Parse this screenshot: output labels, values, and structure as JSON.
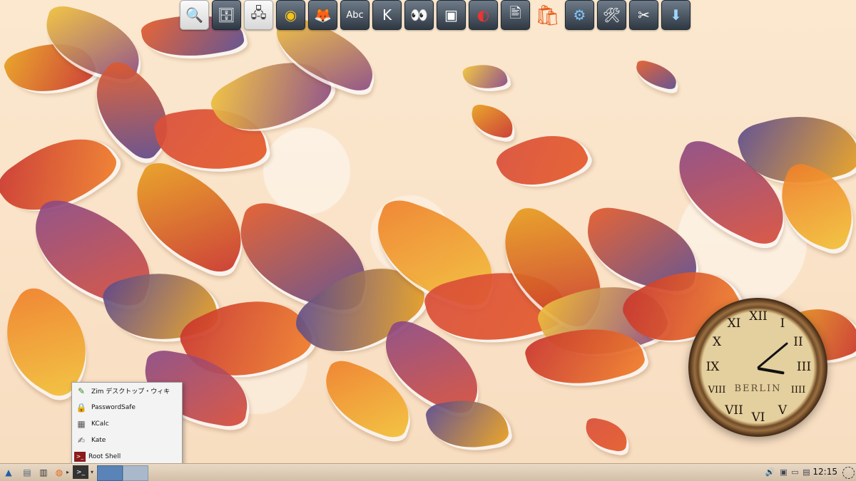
{
  "dock": {
    "items": [
      {
        "name": "search-icon",
        "glyph": "🔍"
      },
      {
        "name": "file-cabinet-icon",
        "glyph": "🗄"
      },
      {
        "name": "network-settings-icon",
        "glyph": "🖧"
      },
      {
        "name": "chrome-icon",
        "glyph": "◉"
      },
      {
        "name": "firefox-icon",
        "glyph": "🦊"
      },
      {
        "name": "text-editor-icon",
        "glyph": "Abc"
      },
      {
        "name": "kde-icon",
        "glyph": "K"
      },
      {
        "name": "eyes-icon",
        "glyph": "👀"
      },
      {
        "name": "screenshot-icon",
        "glyph": "▣"
      },
      {
        "name": "media-icon",
        "glyph": "◐"
      },
      {
        "name": "document-viewer-icon",
        "glyph": "🖹"
      },
      {
        "name": "store-bag-icon",
        "glyph": "🛍"
      },
      {
        "name": "diagram-icon",
        "glyph": "⚙"
      },
      {
        "name": "tools-icon",
        "glyph": "🛠"
      },
      {
        "name": "settings-tools-icon",
        "glyph": "✂"
      },
      {
        "name": "download-icon",
        "glyph": "⬇"
      }
    ]
  },
  "clock": {
    "city": "BERLIN",
    "numerals": [
      "XII",
      "I",
      "II",
      "III",
      "IIII",
      "V",
      "VI",
      "VII",
      "VIII",
      "IX",
      "X",
      "XI"
    ]
  },
  "menu": {
    "items": [
      {
        "label": "Zim デスクトップ・ウィキ",
        "icon": "zim-icon",
        "glyph": "✎"
      },
      {
        "label": "PasswordSafe",
        "icon": "passwordsafe-icon",
        "glyph": "🔒"
      },
      {
        "label": "KCalc",
        "icon": "calculator-icon",
        "glyph": "▦"
      },
      {
        "label": "Kate",
        "icon": "kate-icon",
        "glyph": "✍"
      },
      {
        "label": "Root Shell",
        "icon": "terminal-icon",
        "glyph": ">_"
      }
    ]
  },
  "taskbar": {
    "clock": "12:15"
  },
  "colors": {
    "accent": "#5a84b8",
    "background": "#fbe8cf"
  }
}
